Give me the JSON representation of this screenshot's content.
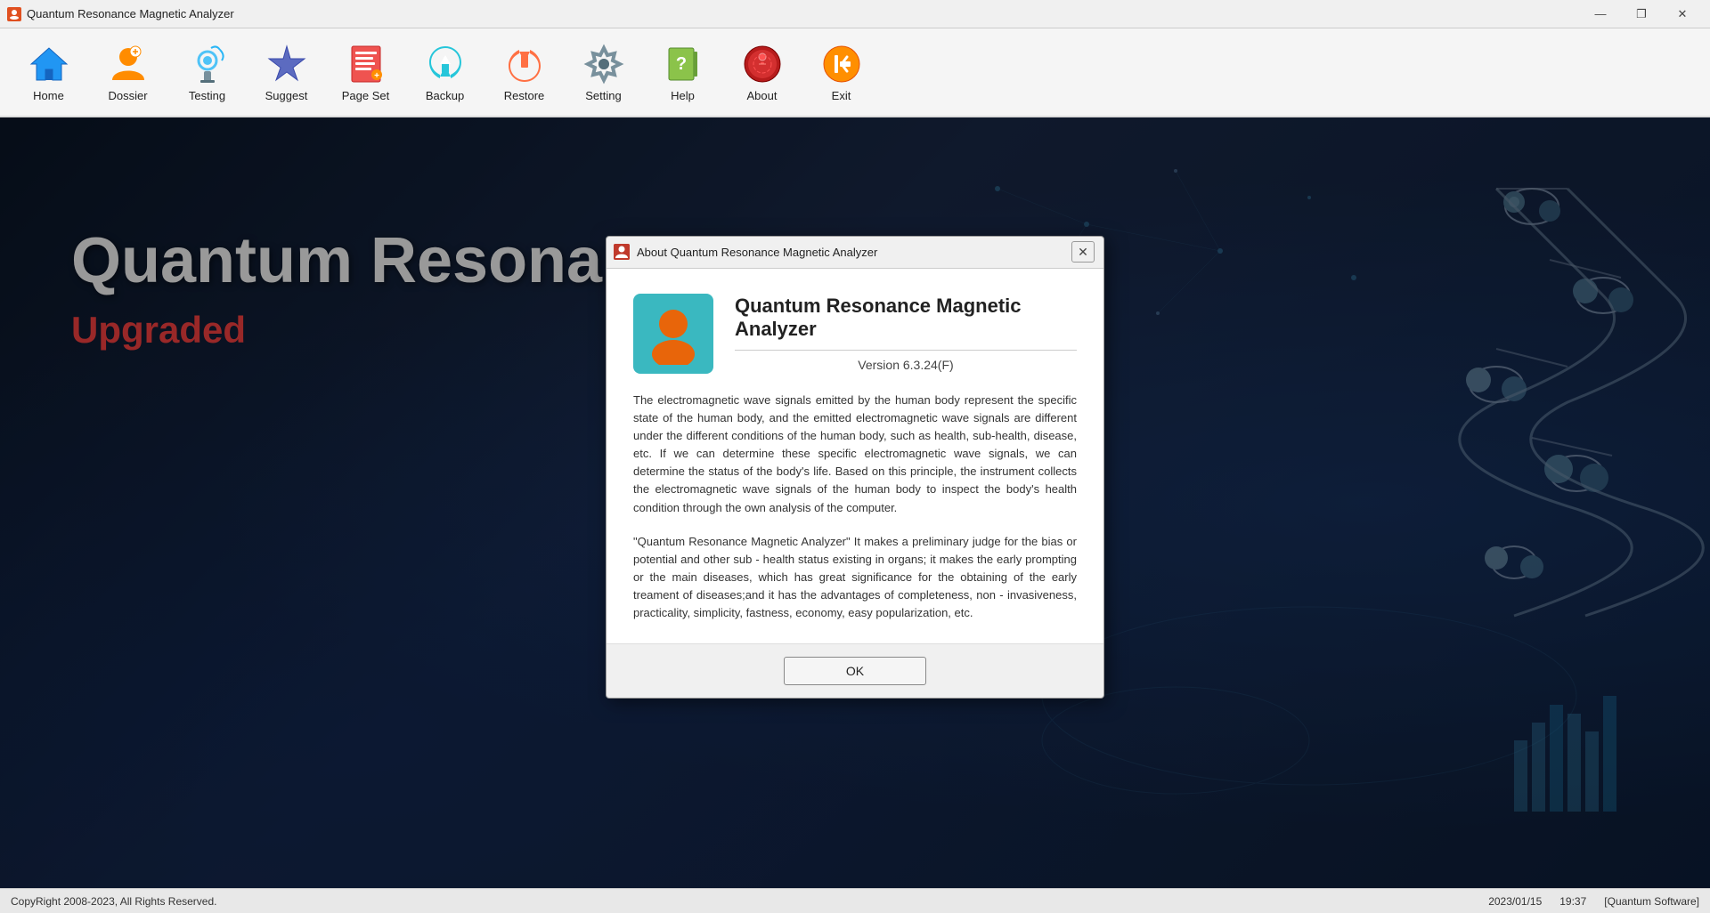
{
  "app": {
    "title": "Quantum Resonance Magnetic Analyzer",
    "icon": "app-icon"
  },
  "titlebar": {
    "title": "Quantum Resonance Magnetic Analyzer",
    "minimize": "—",
    "maximize": "❐",
    "close": "✕"
  },
  "toolbar": {
    "items": [
      {
        "id": "home",
        "label": "Home",
        "icon": "home-icon"
      },
      {
        "id": "dossier",
        "label": "Dossier",
        "icon": "dossier-icon"
      },
      {
        "id": "testing",
        "label": "Testing",
        "icon": "testing-icon"
      },
      {
        "id": "suggest",
        "label": "Suggest",
        "icon": "suggest-icon"
      },
      {
        "id": "pageset",
        "label": "Page Set",
        "icon": "pageset-icon"
      },
      {
        "id": "backup",
        "label": "Backup",
        "icon": "backup-icon"
      },
      {
        "id": "restore",
        "label": "Restore",
        "icon": "restore-icon"
      },
      {
        "id": "setting",
        "label": "Setting",
        "icon": "setting-icon"
      },
      {
        "id": "help",
        "label": "Help",
        "icon": "help-icon"
      },
      {
        "id": "about",
        "label": "About",
        "icon": "about-icon"
      },
      {
        "id": "exit",
        "label": "Exit",
        "icon": "exit-icon"
      }
    ]
  },
  "background": {
    "main_title": "Quantum Resona",
    "subtitle": "Upgraded"
  },
  "dialog": {
    "title": "About Quantum Resonance Magnetic Analyzer",
    "app_name": "Quantum Resonance Magnetic Analyzer",
    "version": "Version 6.3.24(F)",
    "description_1": "The electromagnetic wave signals emitted by the human body represent the specific state of the human body, and the emitted electromagnetic wave signals are different under the different conditions of the human body, such as health, sub-health, disease, etc. If we can determine these specific electromagnetic wave signals, we can determine the status of the body's life. Based on this principle, the instrument collects the electromagnetic wave signals of the human body to inspect the body's health condition through the own analysis of the computer.",
    "description_2": "  \"Quantum Resonance Magnetic Analyzer\" It makes a preliminary judge for the bias or potential and other sub - health status existing in organs; it makes the early prompting or the main diseases, which has great significance for the obtaining of the early treament of diseases;and it has the advantages of completeness, non - invasiveness, practicality, simplicity, fastness, economy, easy popularization, etc.",
    "ok_label": "OK"
  },
  "statusbar": {
    "copyright": "CopyRight 2008-2023, All Rights Reserved.",
    "date": "2023/01/15",
    "time": "19:37",
    "software": "[Quantum Software]"
  }
}
